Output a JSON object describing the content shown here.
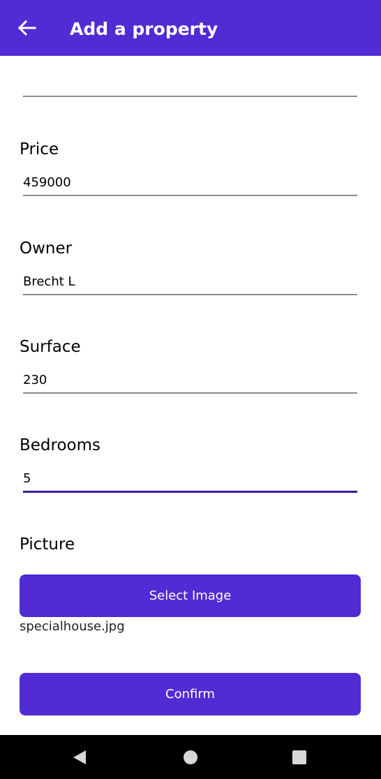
{
  "appbar": {
    "title": "Add a property",
    "back_icon": "arrow-left-icon",
    "color": "#512BD4"
  },
  "fields": {
    "top_value": "",
    "price_label": "Price",
    "price_value": "459000",
    "owner_label": "Owner",
    "owner_value": "Brecht L",
    "surface_label": "Surface",
    "surface_value": "230",
    "bedrooms_label": "Bedrooms",
    "bedrooms_value": "5"
  },
  "picture": {
    "label": "Picture",
    "select_button": "Select Image",
    "filename": "specialhouse.jpg"
  },
  "confirm_button": "Confirm",
  "nav": {
    "back_icon": "triangle-back-icon",
    "home_icon": "circle-home-icon",
    "recents_icon": "square-recents-icon"
  },
  "colors": {
    "accent": "#512BD4",
    "active_underline": "#3a1a9c"
  }
}
